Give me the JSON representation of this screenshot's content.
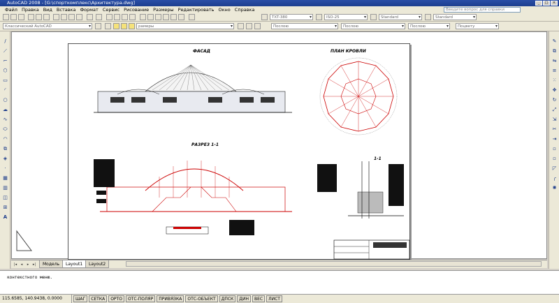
{
  "window": {
    "title": "AutoCAD 2008 - [G:\\спорткомплекс\\Архитектура.dwg]"
  },
  "menu": {
    "items": [
      "Файл",
      "Правка",
      "Вид",
      "Вставка",
      "Формат",
      "Сервис",
      "Рисование",
      "Размеры",
      "Редактировать",
      "Окно",
      "Справка"
    ]
  },
  "help_search": {
    "placeholder": "Введите вопрос для справки"
  },
  "styles": {
    "text_style": "TXT-380",
    "dim_style": "ISO-25",
    "table_style": "Standard",
    "multileader_style": "Standard"
  },
  "workspace": {
    "name": "Классический AutoCAD"
  },
  "layer": {
    "current": "рамеры"
  },
  "properties": {
    "color": "Послою",
    "linetype": "Послою",
    "lineweight": "Послою",
    "plotstyle": "Поцвету"
  },
  "drawing": {
    "facade_title": "ФАСАД",
    "roof_plan_title": "ПЛАН КРОВЛИ",
    "section_title": "РАЗРЕЗ 1-1",
    "detail_label": "1-1"
  },
  "layout_tabs": {
    "model": "Модель",
    "layout1": "Layout1",
    "layout2": "Layout2",
    "active": "Layout1"
  },
  "command_line": {
    "text": "контекстного меню."
  },
  "status_bar": {
    "coordinates": "115.6585, 140.9438, 0.0000",
    "toggles": [
      "ШАГ",
      "СЕТКА",
      "ОРТО",
      "ОТС-ПОЛЯР",
      "ПРИВЯЗКА",
      "ОТС-ОБЪЕКТ",
      "ДПСК",
      "ДИН",
      "ВЕС",
      "ЛИСТ"
    ]
  },
  "colors": {
    "accent_red": "#cc0000",
    "title_blue": "#1d3f8f"
  }
}
